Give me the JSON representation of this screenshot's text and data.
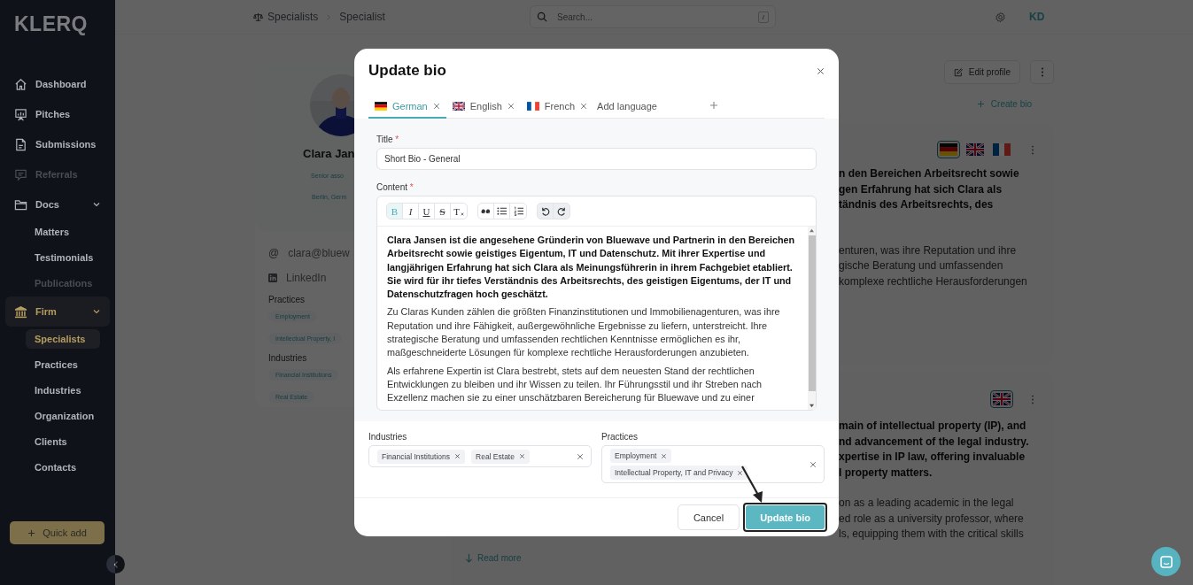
{
  "sidebar": {
    "logo": "KLERQ",
    "items": [
      {
        "label": "Dashboard",
        "kind": "home",
        "selected": false,
        "disabled": false
      },
      {
        "label": "Pitches",
        "kind": "easel",
        "selected": false,
        "disabled": false
      },
      {
        "label": "Submissions",
        "kind": "document",
        "selected": false,
        "disabled": false
      },
      {
        "label": "Referrals",
        "kind": "chat",
        "selected": false,
        "disabled": true
      },
      {
        "label": "Docs",
        "kind": "folder",
        "selected": false,
        "disabled": false,
        "expanded": true,
        "children": [
          {
            "label": "Matters",
            "selected": false,
            "disabled": false
          },
          {
            "label": "Testimonials",
            "selected": false,
            "disabled": false
          },
          {
            "label": "Publications",
            "selected": false,
            "disabled": true
          }
        ]
      },
      {
        "label": "Firm",
        "kind": "bank",
        "selected": true,
        "disabled": false,
        "expanded": true,
        "children": [
          {
            "label": "Specialists",
            "selected": true,
            "disabled": false
          },
          {
            "label": "Practices",
            "selected": false,
            "disabled": false
          },
          {
            "label": "Industries",
            "selected": false,
            "disabled": false
          },
          {
            "label": "Organization",
            "selected": false,
            "disabled": false
          },
          {
            "label": "Clients",
            "selected": false,
            "disabled": false
          },
          {
            "label": "Contacts",
            "selected": false,
            "disabled": false
          }
        ]
      }
    ],
    "quick_add": "Quick add"
  },
  "topbar": {
    "breadcrumb": [
      "Specialists",
      "Specialist"
    ],
    "search": {
      "placeholder": "Search...",
      "shortcut": "/"
    },
    "user": "KD"
  },
  "profile": {
    "name": "Clara Jan",
    "role": "Senior asso",
    "location": "Berlin, Germ",
    "email_mark": "@",
    "email": "clara@bluew",
    "link": "LinkedIn",
    "practices_label": "Practices",
    "practices": [
      "Employment",
      "Intellectual Property, I"
    ],
    "industries_label": "Industries",
    "industries": [
      "Financial Institutions",
      "Real Estate"
    ]
  },
  "actions": {
    "edit": "Edit profile",
    "create": "Create bio"
  },
  "bios": [
    {
      "flags": [
        {
          "kind": "de",
          "selected": true
        },
        {
          "kind": "gb",
          "selected": false
        },
        {
          "kind": "fr",
          "selected": false
        }
      ],
      "bold_lines": [
        "n den Bereichen Arbeitsrecht sowie",
        "gen Erfahrung hat sich Clara als",
        "tändnis des Arbeitsrechts, des"
      ],
      "lines": [
        "enturen, was ihre Reputation und ihre",
        "gische Beratung und umfassenden",
        "komplexe rechtliche Herausforderungen"
      ]
    },
    {
      "flags": [
        {
          "kind": "gb",
          "selected": true
        }
      ],
      "bold_lines": [
        "main of intellectual property (IP), and",
        "nd advancement of the legal industry.",
        "xpertise in IP law, offering invaluable",
        "l property matters."
      ],
      "lines": [
        "on as a leading academic in the legal",
        "ed role as a university professor, where",
        "ls, equipping them with the critical skills"
      ],
      "read_more": "Read more"
    }
  ],
  "modal": {
    "title": "Update bio",
    "tabs": [
      {
        "label": "German",
        "kind": "de",
        "selected": true
      },
      {
        "label": "English",
        "kind": "gb",
        "selected": false
      },
      {
        "label": "French",
        "kind": "fr",
        "selected": false
      }
    ],
    "add_language": "Add language",
    "title_field": {
      "label": "Title",
      "mark": "*",
      "value": "Short Bio - General"
    },
    "content": {
      "label": "Content",
      "mark": "*",
      "toolbar": [
        [
          {
            "kind": "bold",
            "label": "B",
            "active": true
          },
          {
            "kind": "italic",
            "label": "I",
            "active": false
          },
          {
            "kind": "underline",
            "label": "U",
            "active": false
          },
          {
            "kind": "strike",
            "label": "S",
            "active": false
          },
          {
            "kind": "clear",
            "label": "T",
            "active": false
          }
        ],
        [
          {
            "kind": "quote",
            "active": false
          },
          {
            "kind": "bullets",
            "active": false
          },
          {
            "kind": "numbers",
            "active": false
          }
        ],
        [
          {
            "kind": "undo",
            "active": false
          },
          {
            "kind": "redo",
            "active": false
          }
        ]
      ],
      "paragraphs": [
        {
          "bold": true,
          "text": "Clara Jansen ist die angesehene Gründerin von Bluewave und Partnerin in den Bereichen Arbeitsrecht sowie geistiges Eigentum, IT und Datenschutz. Mit ihrer Expertise und langjährigen Erfahrung hat sich Clara als Meinungsführerin in ihrem Fachgebiet etabliert. Sie wird für ihr tiefes Verständnis des Arbeitsrechts, des geistigen Eigentums, der IT und Datenschutzfragen hoch geschätzt."
        },
        {
          "bold": false,
          "text": "Zu Claras Kunden zählen die größten Finanzinstitutionen und Immobilienagenturen, was ihre Reputation und ihre Fähigkeit, außergewöhnliche Ergebnisse zu liefern, unterstreicht. Ihre strategische Beratung und umfassenden rechtlichen Kenntnisse ermöglichen es ihr, maßgeschneiderte Lösungen für komplexe rechtliche Herausforderungen anzubieten."
        },
        {
          "bold": false,
          "text": "Als erfahrene Expertin ist Clara bestrebt, stets auf dem neuesten Stand der rechtlichen Entwicklungen zu bleiben und ihr Wissen zu teilen. Ihr Führungsstil und ihr Streben nach Exzellenz machen sie zu einer unschätzbaren Bereicherung für Bluewave und zu einer"
        }
      ]
    },
    "industries": {
      "label": "Industries",
      "chips": [
        "Financial Institutions",
        "Real Estate"
      ]
    },
    "practices": {
      "label": "Practices",
      "chips": [
        "Employment",
        "Intellectual Property, IT and Privacy"
      ]
    },
    "cancel": "Cancel",
    "submit": "Update bio"
  }
}
